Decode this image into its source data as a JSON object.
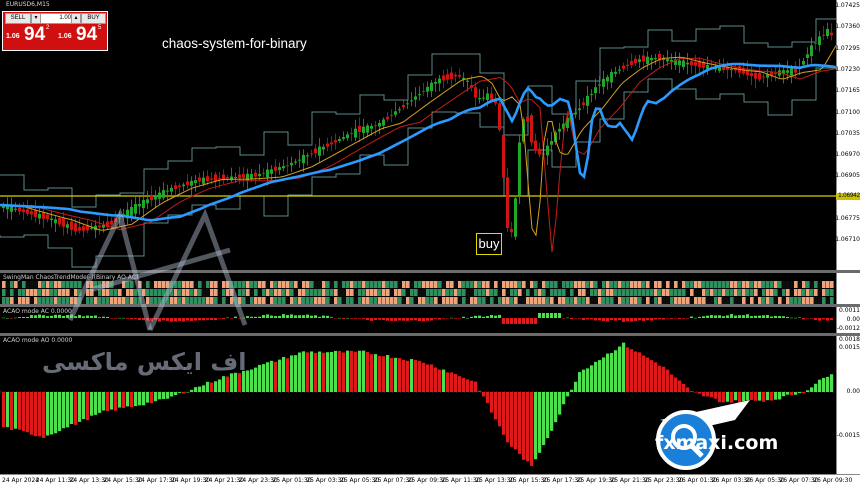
{
  "symbol": "EURUSD6,M15",
  "trade_panel": {
    "sell_label": "SELL",
    "buy_label": "BUY",
    "lot": "1.00",
    "sell_price": {
      "small": "1.06",
      "big": "94",
      "sup": "2"
    },
    "buy_price": {
      "small": "1.06",
      "big": "94",
      "sup": "5"
    }
  },
  "headline": "chaos-system-for-binary",
  "buy_annotation": "buy",
  "price_scale": [
    "1.07425",
    "1.07360",
    "1.07295",
    "1.07230",
    "1.07165",
    "1.07100",
    "1.07035",
    "1.06970",
    "1.06905",
    "1.06840",
    "1.06775",
    "1.06710"
  ],
  "level_label": "1.06942",
  "indicator_1_title": "SwingMan ChaosTrendMode(-)(Binary AO AC)",
  "indicator_2": {
    "title": "ACAO mode AC  0.0000",
    "scale": [
      "0.0011",
      "0.00",
      "-0.0012"
    ]
  },
  "indicator_3": {
    "title": "ACAO mode AO  0.0000",
    "scale": [
      "0.0018",
      "0.0015",
      "0.00",
      "-0.0015"
    ]
  },
  "time_axis": [
    "24 Apr 2024",
    "24 Apr 11:30",
    "24 Apr 13:30",
    "24 Apr 15:30",
    "24 Apr 17:30",
    "24 Apr 19:30",
    "24 Apr 21:30",
    "24 Apr 23:30",
    "25 Apr 01:30",
    "25 Apr 03:30",
    "25 Apr 05:30",
    "25 Apr 07:30",
    "25 Apr 09:30",
    "25 Apr 11:30",
    "25 Apr 13:30",
    "25 Apr 15:30",
    "25 Apr 17:30",
    "25 Apr 19:30",
    "25 Apr 21:30",
    "25 Apr 23:30",
    "26 Apr 01:30",
    "26 Apr 03:30",
    "26 Apr 05:30",
    "26 Apr 07:30",
    "26 Apr 09:30"
  ],
  "watermark": {
    "persian": "اف ایکس ماکسی",
    "brand": "fxmaxi.com"
  },
  "colors": {
    "bull": "#1fa82a",
    "bear": "#d01414",
    "blue_ma": "#2b9bff",
    "level": "#d8cf00",
    "ao_up": "#4ce04c",
    "ao_dn": "#e01a1a"
  }
}
